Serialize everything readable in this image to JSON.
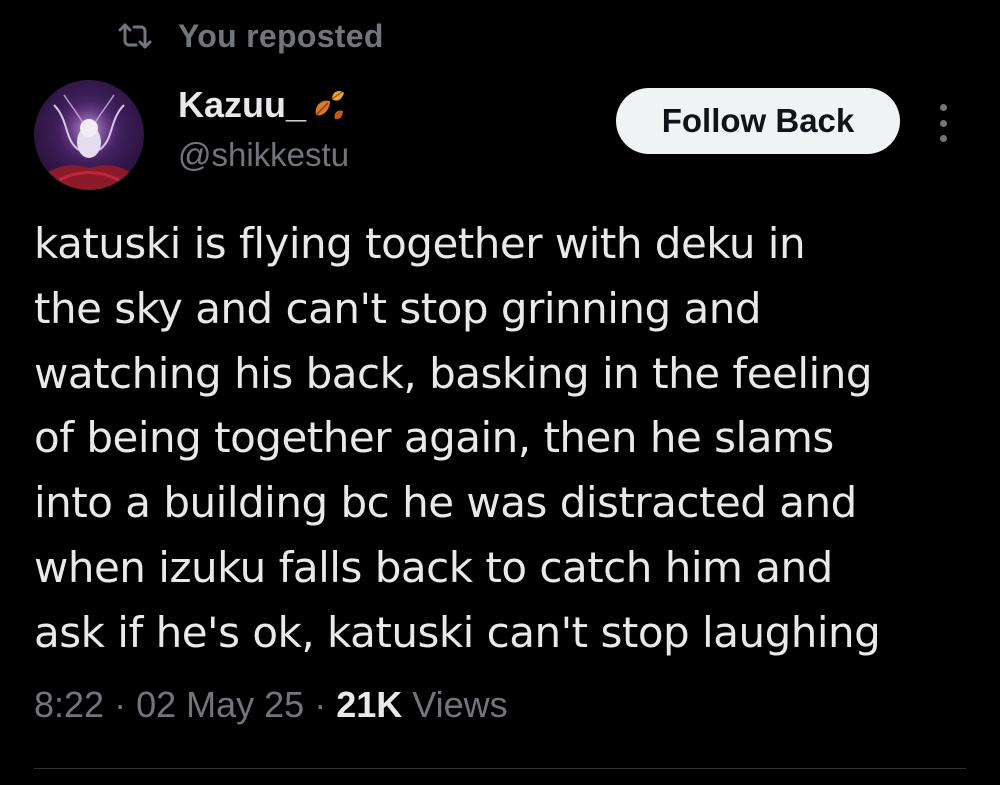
{
  "repost": {
    "icon": "repost-icon",
    "label": "You reposted"
  },
  "author": {
    "avatar": "avatar",
    "display_name": "Kazuu_",
    "name_emoji": "falling-leaves-icon",
    "handle": "@shikkestu"
  },
  "actions": {
    "follow_back_label": "Follow Back",
    "more_icon": "more-vertical-icon"
  },
  "tweet": {
    "text": "katuski is flying together with deku in\nthe sky and can't stop grinning and\nwatching his back, basking in the feeling\nof being together again, then he slams\ninto a building bc he was distracted and\nwhen izuku falls back to catch him and\nask if he's ok, katuski can't stop laughing"
  },
  "meta": {
    "time": "8:22",
    "separator": " · ",
    "date": "02 May 25",
    "views_count": "21K",
    "views_label": " Views"
  },
  "colors": {
    "background": "#000000",
    "primary_text": "#e7e9ea",
    "secondary_text": "#71767b",
    "button_bg": "#eff3f4",
    "button_text": "#0f1419",
    "divider": "#2f3336"
  }
}
